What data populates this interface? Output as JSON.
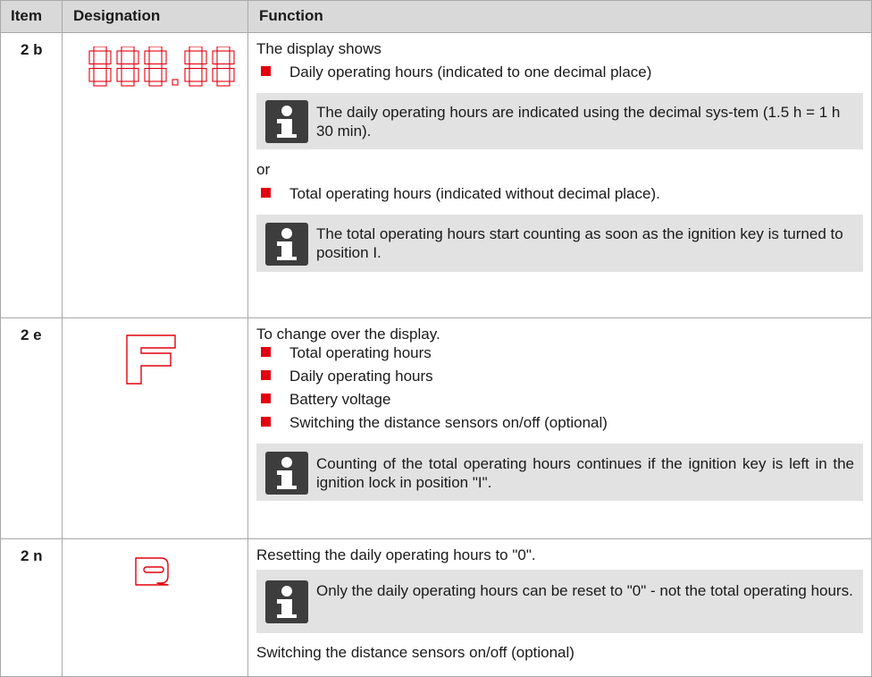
{
  "header": {
    "item": "Item",
    "designation": "Designation",
    "function": "Function"
  },
  "colors": {
    "accent": "#e3000f",
    "note_bg": "#e2e2e2",
    "header_bg": "#d9d9d9",
    "icon_bg": "#3d3d3d"
  },
  "rows": [
    {
      "item": "2 b",
      "designation_icon": "seven-segment-display-888-88",
      "intro": "The display shows",
      "bullet1": "Daily operating hours (indicated to one decimal place)",
      "note1": "The daily operating hours are indicated using the decimal sys-tem (1.5 h = 1 h 30 min).",
      "or": "or",
      "bullet2": "Total operating hours (indicated without decimal place).",
      "note2": "The total operating hours start counting as soon as the ignition key is turned to position I."
    },
    {
      "item": "2 e",
      "designation_icon": "f-key-icon",
      "intro": "To change over the display.",
      "bullets": [
        "Total operating hours",
        "Daily operating hours",
        "Battery voltage",
        "Switching the distance sensors on/off (optional)"
      ],
      "note": "Counting of the total operating hours continues if the ignition key is left in the ignition lock in position \"I\"."
    },
    {
      "item": "2 n",
      "designation_icon": "r-key-icon",
      "intro": "Resetting the daily operating hours to \"0\".",
      "note": "Only the daily operating hours can be reset to \"0\" - not the total operating hours.",
      "outro": "Switching the distance sensors on/off (optional)"
    }
  ]
}
